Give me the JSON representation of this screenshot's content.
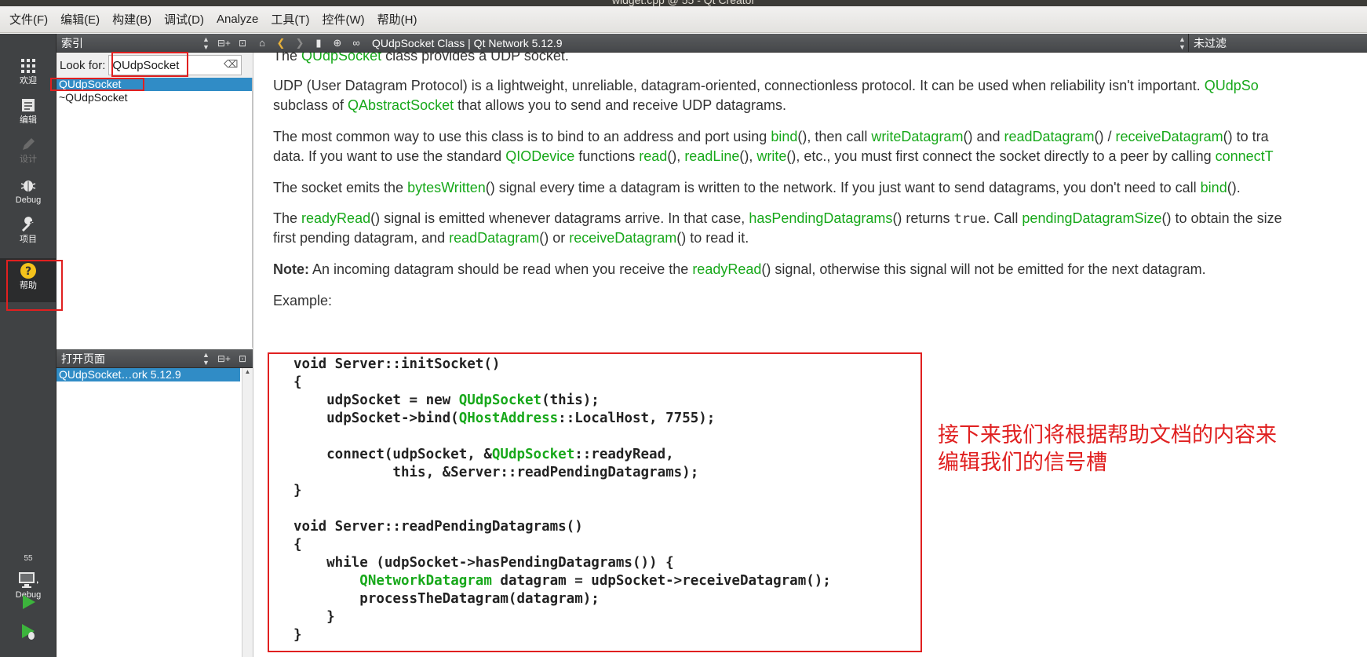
{
  "window": {
    "title": "widget.cpp @ 55 - Qt Creator"
  },
  "menubar": {
    "items": [
      "文件(F)",
      "编辑(E)",
      "构建(B)",
      "调试(D)",
      "Analyze",
      "工具(T)",
      "控件(W)",
      "帮助(H)"
    ]
  },
  "modes": {
    "welcome": "欢迎",
    "edit": "编辑",
    "design": "设计",
    "debug": "Debug",
    "projects": "项目",
    "help": "帮助"
  },
  "kit": {
    "name": "55",
    "config": "Debug"
  },
  "sidebar": {
    "index_title": "索引",
    "look_for_label": "Look for:",
    "look_for_value": "QUdpSocket",
    "index_items": [
      "QUdpSocket",
      "~QUdpSocket"
    ],
    "open_pages_title": "打开页面",
    "open_pages": [
      "QUdpSocket…ork 5.12.9"
    ]
  },
  "help_toolbar": {
    "page_title": "QUdpSocket Class | Qt Network 5.12.9",
    "filter": "未过滤"
  },
  "doc": {
    "intro": {
      "pre": "The ",
      "link": "QUdpSocket",
      "post": " class provides a UDP socket."
    },
    "udp_line1": {
      "pre": "UDP (User Datagram Protocol) is a lightweight, unreliable, datagram-oriented, connectionless protocol. It can be used when reliability isn't important. ",
      "link": "QUdpSo"
    },
    "udp_line2": {
      "pre": "subclass of ",
      "link": "QAbstractSocket",
      "post": " that allows you to send and receive UDP datagrams."
    },
    "common_line1": {
      "a": "The most common way to use this class is to bind to an address and port using ",
      "bind": "bind",
      "b": "(), then call ",
      "write": "writeDatagram",
      "c": "() and ",
      "read": "readDatagram",
      "d": "() / ",
      "receive": "receiveDatagram",
      "e": "() to tra"
    },
    "common_line2": {
      "a": "data. If you want to use the standard ",
      "qiodevice": "QIODevice",
      "b": " functions ",
      "read": "read",
      "c": "(), ",
      "readline": "readLine",
      "d": "(), ",
      "write": "write",
      "e": "(), etc., you must first connect the socket directly to a peer by calling ",
      "connect": "connectT"
    },
    "emits_line": {
      "a": "The socket emits the ",
      "bytes": "bytesWritten",
      "b": "() signal every time a datagram is written to the network. If you just want to send datagrams, you don't need to call ",
      "bind": "bind",
      "c": "()."
    },
    "ready_line1": {
      "a": "The ",
      "ready": "readyRead",
      "b": "() signal is emitted whenever datagrams arrive. In that case, ",
      "has": "hasPendingDatagrams",
      "c": "() returns ",
      "true": "true",
      "d": ". Call ",
      "size": "pendingDatagramSize",
      "e": "() to obtain the size"
    },
    "ready_line2": {
      "a": "first pending datagram, and ",
      "read": "readDatagram",
      "b": "() or ",
      "receive": "receiveDatagram",
      "c": "() to read it."
    },
    "note": {
      "bold": "Note:",
      "a": " An incoming datagram should be read when you receive the ",
      "ready": "readyRead",
      "b": "() signal, otherwise this signal will not be emitted for the next datagram."
    },
    "example": "Example:",
    "code": {
      "l1": "void Server::initSocket()",
      "l2": "{",
      "l3a": "    udpSocket = new ",
      "l3t": "QUdpSocket",
      "l3b": "(this);",
      "l4a": "    udpSocket->bind(",
      "l4t": "QHostAddress",
      "l4b": "::LocalHost, 7755);",
      "l5a": "    connect(udpSocket, &",
      "l5t": "QUdpSocket",
      "l5b": "::readyRead,",
      "l6": "            this, &Server::readPendingDatagrams);",
      "l7": "}",
      "l8": "void Server::readPendingDatagrams()",
      "l9": "{",
      "l10": "    while (udpSocket->hasPendingDatagrams()) {",
      "l11t": "QNetworkDatagram",
      "l11b": " datagram = udpSocket->receiveDatagram();",
      "l12": "        processTheDatagram(datagram);",
      "l13": "    }",
      "l14": "}"
    }
  },
  "annotation": {
    "line1": "接下来我们将根据帮助文档的内容来",
    "line2": "编辑我们的信号槽"
  },
  "colors": {
    "link": "#17a81a",
    "selection": "#308cc6",
    "annotation": "#e02020"
  }
}
